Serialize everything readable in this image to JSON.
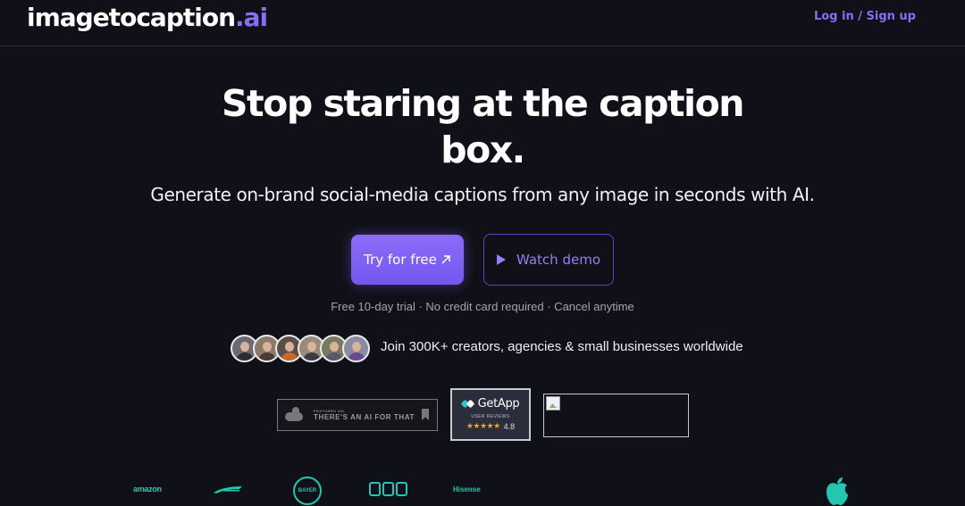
{
  "header": {
    "logo_main": "imagetocaption",
    "logo_accent": ".ai",
    "login_label": "Log in / Sign up"
  },
  "hero": {
    "title_line1": "Stop staring at the caption",
    "title_line2": "box.",
    "subtitle": "Generate on-brand social-media captions from any image in seconds with AI."
  },
  "cta": {
    "try_label": "Try for free",
    "try_icon": "arrow-up-right-icon",
    "demo_label": "Watch demo",
    "demo_icon": "play-icon"
  },
  "trial_note": "Free 10-day trial · No credit card required · Cancel anytime",
  "social_proof": {
    "avatar_count": 6,
    "text": "Join 300K+ creators, agencies & small businesses worldwide"
  },
  "badges": {
    "taaft_small": "FEATURED ON",
    "taaft_big": "THERE'S AN AI FOR THAT",
    "getapp_name": "GetApp",
    "getapp_reviews": "USER REVIEWS",
    "getapp_stars": "★★★★★",
    "getapp_rating": "4.8"
  },
  "brand_logos": {
    "amazon": "amazon",
    "bayer": "BAYER",
    "hisense": "Hisense"
  },
  "colors": {
    "background": "#101018",
    "accent": "#8b6cf6",
    "brand_logo": "#24c6b2",
    "star": "#ff9d28"
  }
}
